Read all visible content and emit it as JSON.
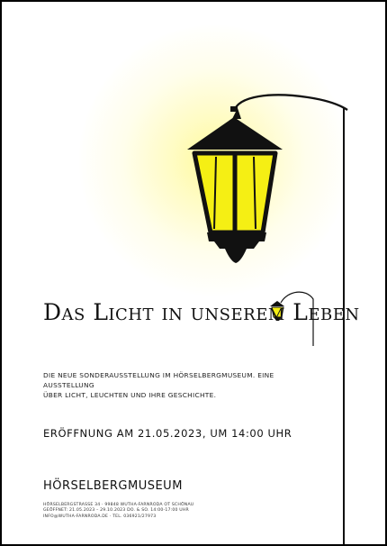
{
  "poster": {
    "title": "Das Licht in unserem Leben",
    "intro_line1": "Die neue Sonderausstellung im Hörselbergmuseum. Eine Ausstellung",
    "intro_line2": "über Licht, Leuchten und ihre Geschichte.",
    "opening": "Eröffnung am 21.05.2023, um 14:00 Uhr",
    "museum_name": "Hörselbergmuseum",
    "contact_lines": [
      "Hörselbergstraße 34 · 99848 Wutha-Farnroda OT Schönau",
      "Geöffnet: 21.05.2023 – 29.10.2023 Do. & So. 14:00-17:00 Uhr",
      "info@wutha-farnroda.de · Tel. 036921/27973"
    ]
  },
  "colors": {
    "lamp_glass": "#f5ef14",
    "lamp_frame": "#111111",
    "glow": "#fffbb0"
  }
}
